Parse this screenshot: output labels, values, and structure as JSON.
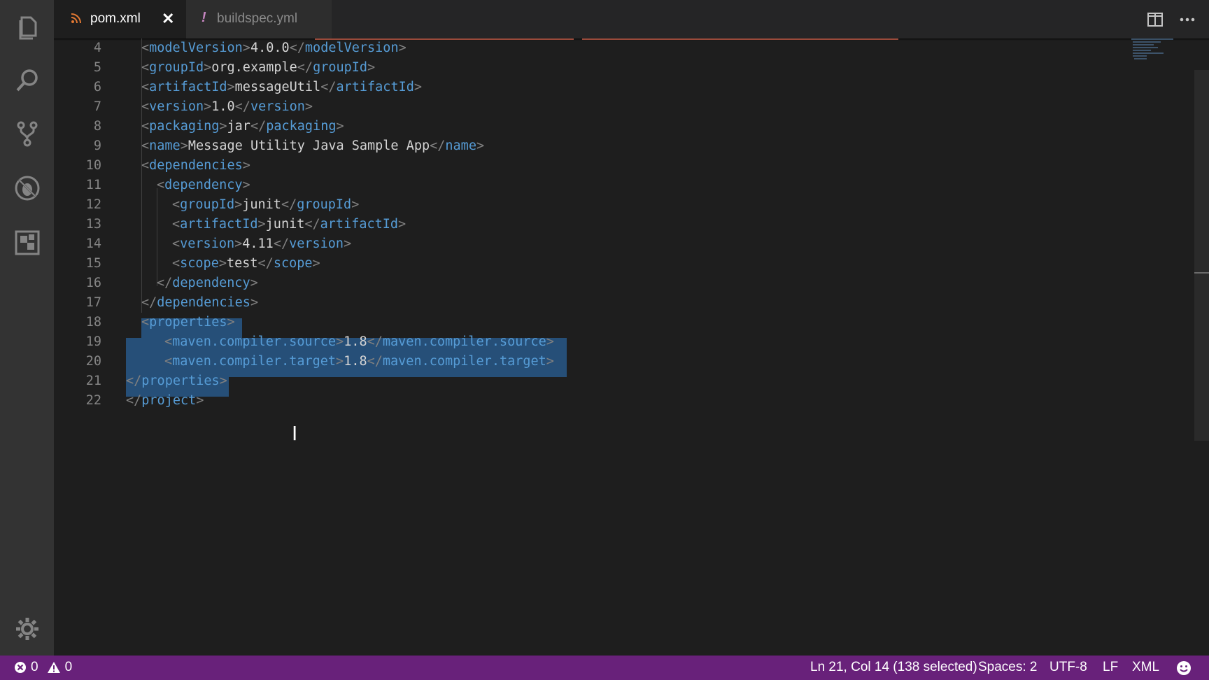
{
  "tabs": [
    {
      "label": "pom.xml",
      "icon": "rss-icon",
      "active": true,
      "close": "✕"
    },
    {
      "label": "buildspec.yml",
      "icon": "exclamation-icon",
      "active": false,
      "mark": "!"
    }
  ],
  "editor": {
    "line_numbers": [
      "4",
      "5",
      "6",
      "7",
      "8",
      "9",
      "10",
      "11",
      "12",
      "13",
      "14",
      "15",
      "16",
      "17",
      "18",
      "19",
      "20",
      "21",
      "22"
    ],
    "lines": [
      {
        "open": "modelVersion",
        "text": "4.0.0",
        "close": "modelVersion"
      },
      {
        "open": "groupId",
        "text": "org.example",
        "close": "groupId"
      },
      {
        "open": "artifactId",
        "text": "messageUtil",
        "close": "artifactId"
      },
      {
        "open": "version",
        "text": "1.0",
        "close": "version"
      },
      {
        "open": "packaging",
        "text": "jar",
        "close": "packaging"
      },
      {
        "open": "name",
        "text": "Message Utility Java Sample App",
        "close": "name"
      },
      {
        "open": "dependencies"
      },
      {
        "open": "dependency"
      },
      {
        "open": "groupId",
        "text": "junit",
        "close": "groupId"
      },
      {
        "open": "artifactId",
        "text": "junit",
        "close": "artifactId"
      },
      {
        "open": "version",
        "text": "4.11",
        "close": "version"
      },
      {
        "open": "scope",
        "text": "test",
        "close": "scope"
      },
      {
        "close": "dependency"
      },
      {
        "close": "dependencies"
      },
      {
        "open": "properties"
      },
      {
        "open": "maven.compiler.source",
        "text": "1.8",
        "close": "maven.compiler.source"
      },
      {
        "open": "maven.compiler.target",
        "text": "1.8",
        "close": "maven.compiler.target"
      },
      {
        "close": "properties"
      },
      {
        "close": "project"
      }
    ]
  },
  "statusbar": {
    "errors": "0",
    "warnings": "0",
    "position": "Ln 21, Col 14 (138 selected)",
    "spaces": "Spaces: 2",
    "encoding": "UTF-8",
    "eol": "LF",
    "language": "XML"
  },
  "colors": {
    "statusbar": "#68217a",
    "tag": "#569cd6",
    "selection": "#264f78",
    "activitybar": "#333333"
  }
}
